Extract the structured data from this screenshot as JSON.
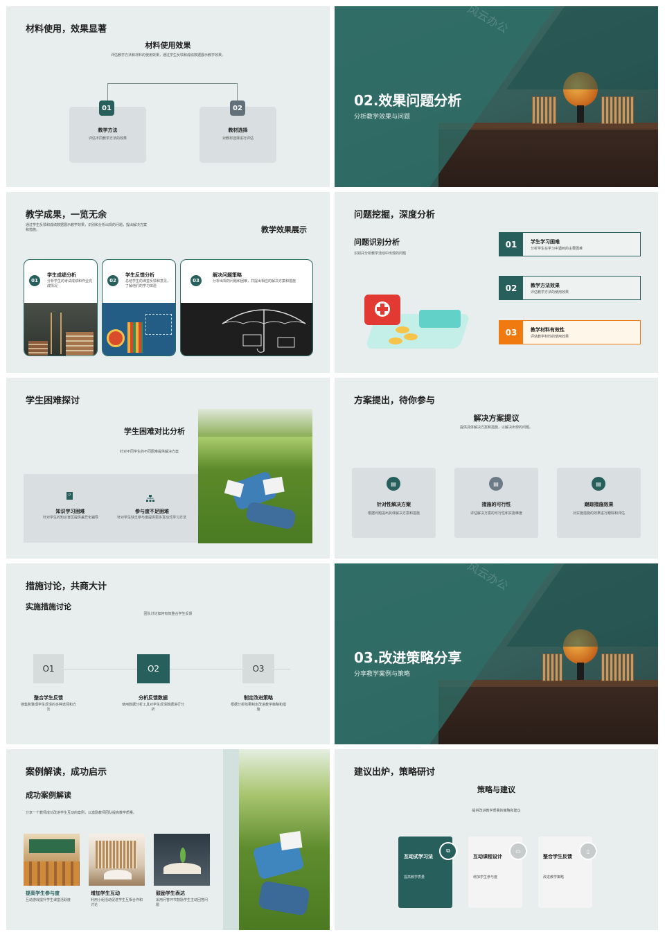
{
  "s1": {
    "heading": "材料使用，效果显著",
    "title": "材料使用效果",
    "desc": "评估教学方法和材料的使用效果，通过学生反馈和成绩数据展示教学效果。",
    "cards": [
      {
        "num": "01",
        "title": "教学方法",
        "text": "评估不同教学方法的效果"
      },
      {
        "num": "02",
        "title": "教材选择",
        "text": "对教材选择进行评估"
      }
    ]
  },
  "s2": {
    "title": "02.效果问题分析",
    "sub": "分析教学效果与问题",
    "watermark": "风云办公"
  },
  "s3": {
    "heading": "教学成果，一览无余",
    "desc": "通过学生反馈和成绩数据展示教学效果，识别和分析出现的问题，提出解决方案和措施。",
    "side_title": "教学效果展示",
    "cards": [
      {
        "num": "01",
        "title": "学生成绩分析",
        "text": "分析学生的考试成绩和作业完成情况"
      },
      {
        "num": "02",
        "title": "学生反馈分析",
        "text": "总结学生的课堂反馈和意见，了解他们的学习体验"
      },
      {
        "num": "03",
        "title": "解决问题策略",
        "text": "分析出现的问题和困难，并提出相应的解决方案和措施"
      }
    ]
  },
  "s4": {
    "heading": "问题挖掘，深度分析",
    "sub_title": "问题识别分析",
    "sub_desc": "识别并分析教学活动中出现的问题",
    "items": [
      {
        "num": "01",
        "title": "学生学习困难",
        "text": "分析学生在学习中遇到的主要困难"
      },
      {
        "num": "02",
        "title": "教学方法效果",
        "text": "评估教学方法的使用效果"
      },
      {
        "num": "03",
        "title": "教学材料有效性",
        "text": "评估教学材料的使用效果"
      }
    ]
  },
  "s5": {
    "heading": "学生困难探讨",
    "title": "学生困难对比分析",
    "desc": "针对不同学生的不同困难提供解决方案",
    "items": [
      {
        "title": "知识学习困难",
        "text": "针对学生的知识盲区提供差异化辅导"
      },
      {
        "title": "参与度不足困难",
        "text": "针对学生缺乏参与度提供更多互动式学习方法"
      }
    ]
  },
  "s6": {
    "heading": "方案提出，待你参与",
    "title": "解决方案提议",
    "desc": "提供具体解决方案和措施，以解决出现的问题。",
    "cards": [
      {
        "title": "针对性解决方案",
        "text": "根据问题提出具体解决方案和措施"
      },
      {
        "title": "措施的可行性",
        "text": "评估解决方案的可行性和实施难度"
      },
      {
        "title": "跟踪措施效果",
        "text": "对实施措施的效果进行跟踪和评估"
      }
    ]
  },
  "s7": {
    "heading": "措施讨论，共商大计",
    "sub_title": "实施措施讨论",
    "desc": "团队讨论如何有效整合学生反馈",
    "steps": [
      {
        "num": "O1",
        "title": "整合学生反馈",
        "text": "搜集和整理学生反馈的多种途径和方法"
      },
      {
        "num": "O2",
        "title": "分析反馈数据",
        "text": "使用数据分析工具对学生反馈数据进行分析"
      },
      {
        "num": "O3",
        "title": "制定改进策略",
        "text": "根据分析结果制定改进教学策略和措施"
      }
    ]
  },
  "s8": {
    "title": "03.改进策略分享",
    "sub": "分享教学案例与策略",
    "watermark": "风云办公"
  },
  "s9": {
    "heading": "案例解读，成功启示",
    "sub_title": "成功案例解读",
    "desc": "分享一个教师成功改进学生互动的案例，以激励教师团队提高教学质量。",
    "cards": [
      {
        "title": "提高学生参与度",
        "text": "互动游戏提升学生课堂活跃度"
      },
      {
        "title": "增加学生互动",
        "text": "利用小组活动促进学生互相合作和讨论"
      },
      {
        "title": "鼓励学生表达",
        "text": "采用问答环节鼓励学生主动回答问题"
      }
    ]
  },
  "s10": {
    "heading": "建议出炉，策略研讨",
    "title": "策略与建议",
    "desc": "提供改进教学质量的策略和建议",
    "cards": [
      {
        "title": "互动式学习法",
        "text": "提高教学质量"
      },
      {
        "title": "互动课程设计",
        "text": "增加学生参与度"
      },
      {
        "title": "整合学生反馈",
        "text": "改进教学策略"
      }
    ]
  },
  "colors": {
    "teal": "#275f5d",
    "orange": "#f07a10",
    "bg": "#e7eeed"
  }
}
